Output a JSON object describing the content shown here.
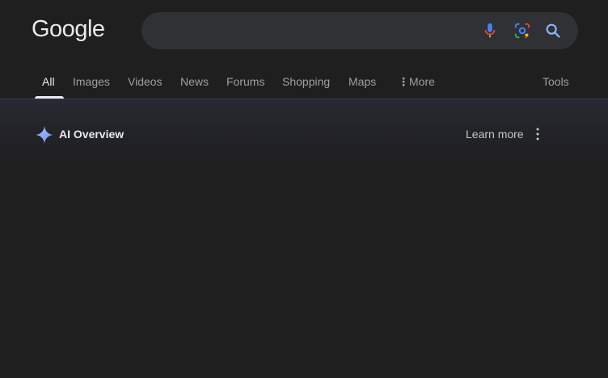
{
  "header": {
    "logo_text": "Google",
    "search": {
      "value": "",
      "placeholder": ""
    }
  },
  "tabs": [
    {
      "label": "All",
      "active": true
    },
    {
      "label": "Images"
    },
    {
      "label": "Videos"
    },
    {
      "label": "News"
    },
    {
      "label": "Forums"
    },
    {
      "label": "Shopping"
    },
    {
      "label": "Maps"
    },
    {
      "label": "More"
    }
  ],
  "tools_label": "Tools",
  "ai_overview": {
    "title": "AI Overview",
    "learn_more": "Learn more"
  },
  "icons": {
    "mic": "microphone-icon",
    "lens": "google-lens-icon",
    "search": "search-icon",
    "more": "vertical-dots-icon",
    "ai": "sparkle-icon",
    "menu": "kebab-menu-icon"
  },
  "colors": {
    "background": "#1f1f1f",
    "search_bg": "#303134",
    "text_primary": "#e8eaed",
    "text_secondary": "#9aa0a6",
    "search_icon": "#8ab4f8",
    "ai_accent": "#8ab4f8"
  }
}
